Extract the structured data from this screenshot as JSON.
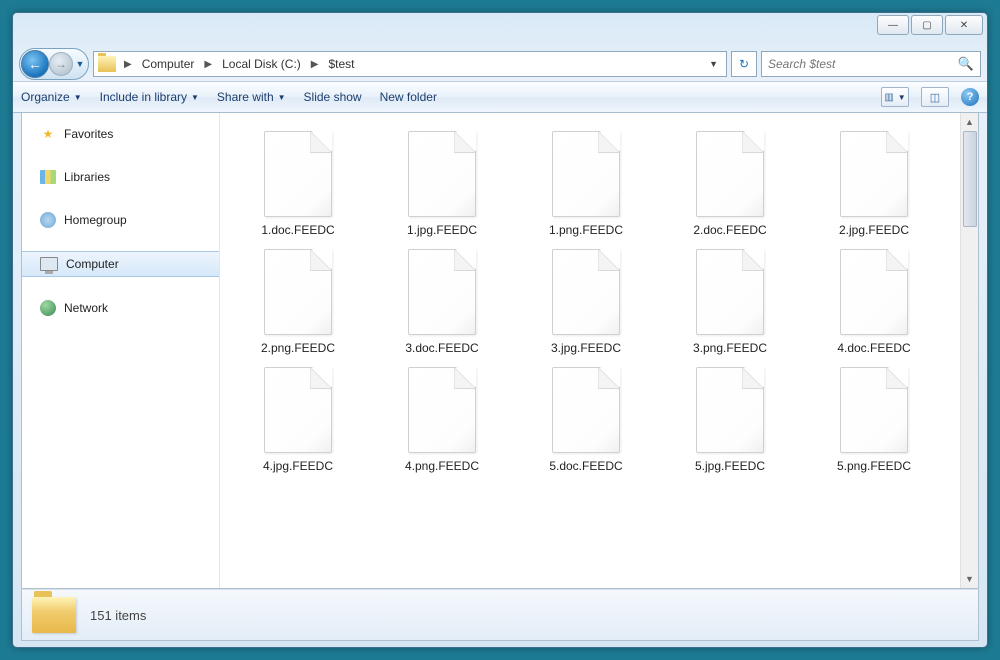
{
  "window_controls": {
    "min": "—",
    "max": "▢",
    "close": "✕"
  },
  "breadcrumb": [
    "Computer",
    "Local Disk (C:)",
    "$test"
  ],
  "search": {
    "placeholder": "Search $test"
  },
  "toolbar": {
    "organize": "Organize",
    "include": "Include in library",
    "share": "Share with",
    "slideshow": "Slide show",
    "newfolder": "New folder"
  },
  "sidebar": {
    "favorites": "Favorites",
    "libraries": "Libraries",
    "homegroup": "Homegroup",
    "computer": "Computer",
    "network": "Network"
  },
  "files": [
    "1.doc.FEEDC",
    "1.jpg.FEEDC",
    "1.png.FEEDC",
    "2.doc.FEEDC",
    "2.jpg.FEEDC",
    "2.png.FEEDC",
    "3.doc.FEEDC",
    "3.jpg.FEEDC",
    "3.png.FEEDC",
    "4.doc.FEEDC",
    "4.jpg.FEEDC",
    "4.png.FEEDC",
    "5.doc.FEEDC",
    "5.jpg.FEEDC",
    "5.png.FEEDC"
  ],
  "status": {
    "count": "151 items"
  }
}
